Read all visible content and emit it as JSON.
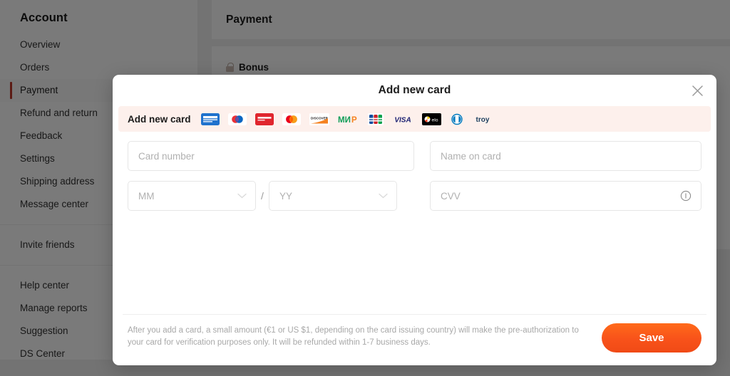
{
  "sidebar": {
    "title": "Account",
    "groups": [
      {
        "items": [
          {
            "label": "Overview",
            "active": false
          },
          {
            "label": "Orders",
            "active": false
          },
          {
            "label": "Payment",
            "active": true
          },
          {
            "label": "Refund and return",
            "active": false
          },
          {
            "label": "Feedback",
            "active": false
          },
          {
            "label": "Settings",
            "active": false
          },
          {
            "label": "Shipping address",
            "active": false
          },
          {
            "label": "Message center",
            "active": false
          }
        ]
      },
      {
        "items": [
          {
            "label": "Invite friends",
            "active": false
          }
        ]
      },
      {
        "items": [
          {
            "label": "Help center",
            "active": false
          },
          {
            "label": "Manage reports",
            "active": false
          },
          {
            "label": "Suggestion",
            "active": false
          },
          {
            "label": "DS Center",
            "active": false
          }
        ]
      }
    ]
  },
  "background": {
    "page_title": "Payment",
    "bonus_label": "Bonus",
    "bonus_icon": "lock-icon"
  },
  "modal": {
    "title": "Add new card",
    "close_icon": "close-icon",
    "banner": {
      "label": "Add new card",
      "background": "#fdf0ec",
      "brands": [
        "american-express",
        "maestro",
        "diners-red",
        "mastercard",
        "discover",
        "mir",
        "jcb",
        "visa",
        "elo",
        "diners-club",
        "troy"
      ]
    },
    "form": {
      "card_number_placeholder": "Card number",
      "name_on_card_placeholder": "Name on card",
      "month_placeholder": "MM",
      "year_placeholder": "YY",
      "separator": "/",
      "cvv_placeholder": "CVV",
      "cvv_info_icon": "info-icon",
      "chevron_icon": "chevron-down-icon"
    },
    "footer": {
      "note": "After you add a card, a small amount (€1 or US $1, depending on the card issuing country) will make the pre-authorization to your card for verification purposes only. It will be refunded within 1-7 business days.",
      "save_label": "Save",
      "save_color": "#f8521a"
    }
  }
}
